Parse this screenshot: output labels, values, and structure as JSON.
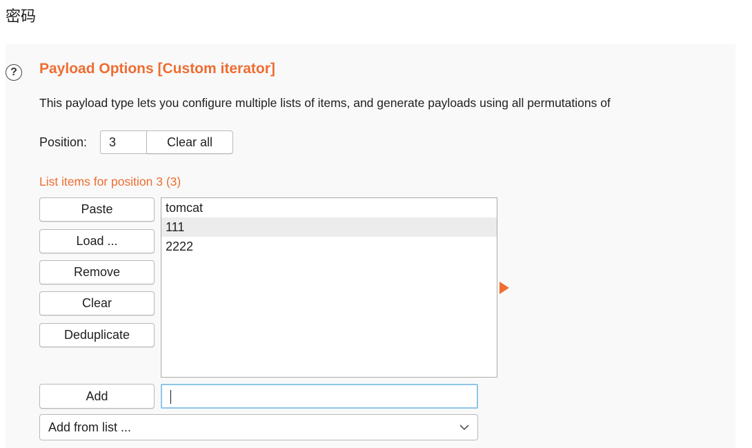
{
  "caption": "密码",
  "panel": {
    "help_glyph": "?",
    "title": "Payload Options [Custom iterator]",
    "description": "This payload type lets you configure multiple lists of items, and generate payloads using all permutations of",
    "position_label": "Position:",
    "position_value": "3",
    "clear_all_label": "Clear all",
    "list_label": "List items for position 3 (3)",
    "buttons": {
      "paste": "Paste",
      "load": "Load ...",
      "remove": "Remove",
      "clear": "Clear",
      "deduplicate": "Deduplicate",
      "add": "Add"
    },
    "list_items": [
      "tomcat",
      "111",
      "2222"
    ],
    "selected_index": 1,
    "add_input_value": "",
    "add_from_list_label": "Add from list ...",
    "accent_color": "#ee6d31"
  }
}
